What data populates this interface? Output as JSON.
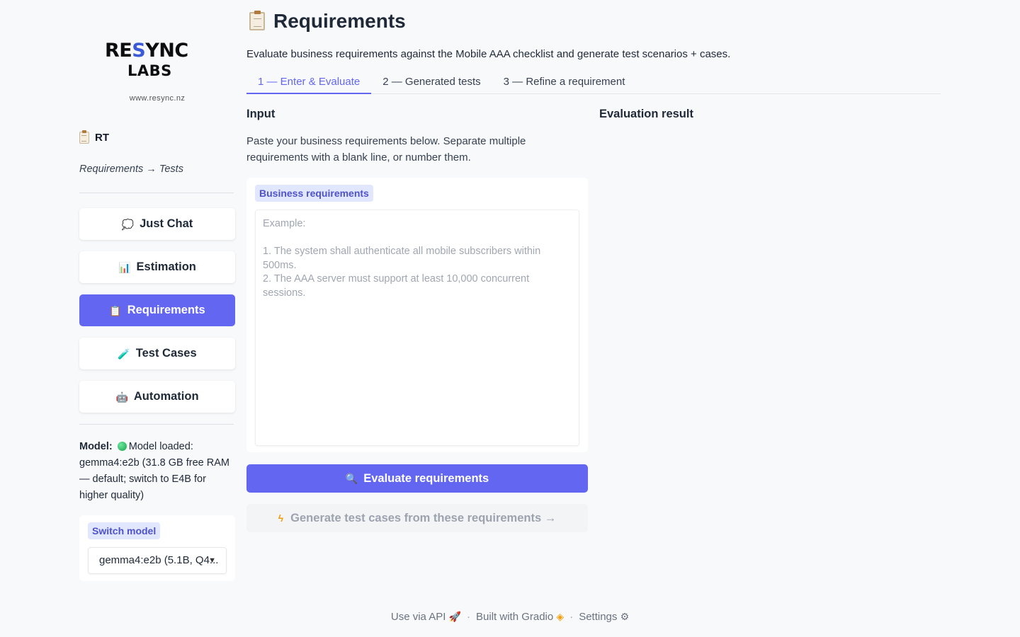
{
  "brand": {
    "logo_top_pre": "RE",
    "logo_top_s": "S",
    "logo_top_post": "YNC",
    "logo_bottom": "LABS",
    "site_url": "www.resync.nz",
    "app_name": "RT",
    "app_subtitle": "Requirements → Tests"
  },
  "nav": [
    {
      "label": "Just Chat",
      "icon": "speech-bubble-icon",
      "glyph": "💭",
      "active": false
    },
    {
      "label": "Estimation",
      "icon": "bar-chart-icon",
      "glyph": "📊",
      "active": false
    },
    {
      "label": "Requirements",
      "icon": "clipboard-icon",
      "glyph": "📋",
      "active": true
    },
    {
      "label": "Test Cases",
      "icon": "test-tube-icon",
      "glyph": "🧪",
      "active": false
    },
    {
      "label": "Automation",
      "icon": "robot-icon",
      "glyph": "🤖",
      "active": false
    }
  ],
  "model": {
    "label": "Model:",
    "status": "Model loaded: gemma4:e2b (31.8 GB free RAM — default; switch to E4B for higher quality)",
    "switch_label": "Switch model",
    "selected": "gemma4:e2b  (5.1B, Q4..."
  },
  "page": {
    "title": "Requirements",
    "description": "Evaluate business requirements against the Mobile AAA checklist and generate test scenarios + cases.",
    "tabs": [
      {
        "label": "1 — Enter & Evaluate",
        "active": true
      },
      {
        "label": "2 — Generated tests",
        "active": false
      },
      {
        "label": "3 — Refine a requirement",
        "active": false
      }
    ],
    "input_heading": "Input",
    "result_heading": "Evaluation result",
    "input_help": "Paste your business requirements below. Separate multiple requirements with a blank line, or number them.",
    "field_label": "Business requirements",
    "placeholder": "Example:\n\n1. The system shall authenticate all mobile subscribers within 500ms.\n2. The AAA server must support at least 10,000 concurrent sessions.",
    "evaluate_button": "Evaluate requirements",
    "generate_button": "Generate test cases from these requirements →"
  },
  "footer": {
    "api": "Use via API",
    "built": "Built with Gradio",
    "settings": "Settings",
    "dot": "·"
  }
}
